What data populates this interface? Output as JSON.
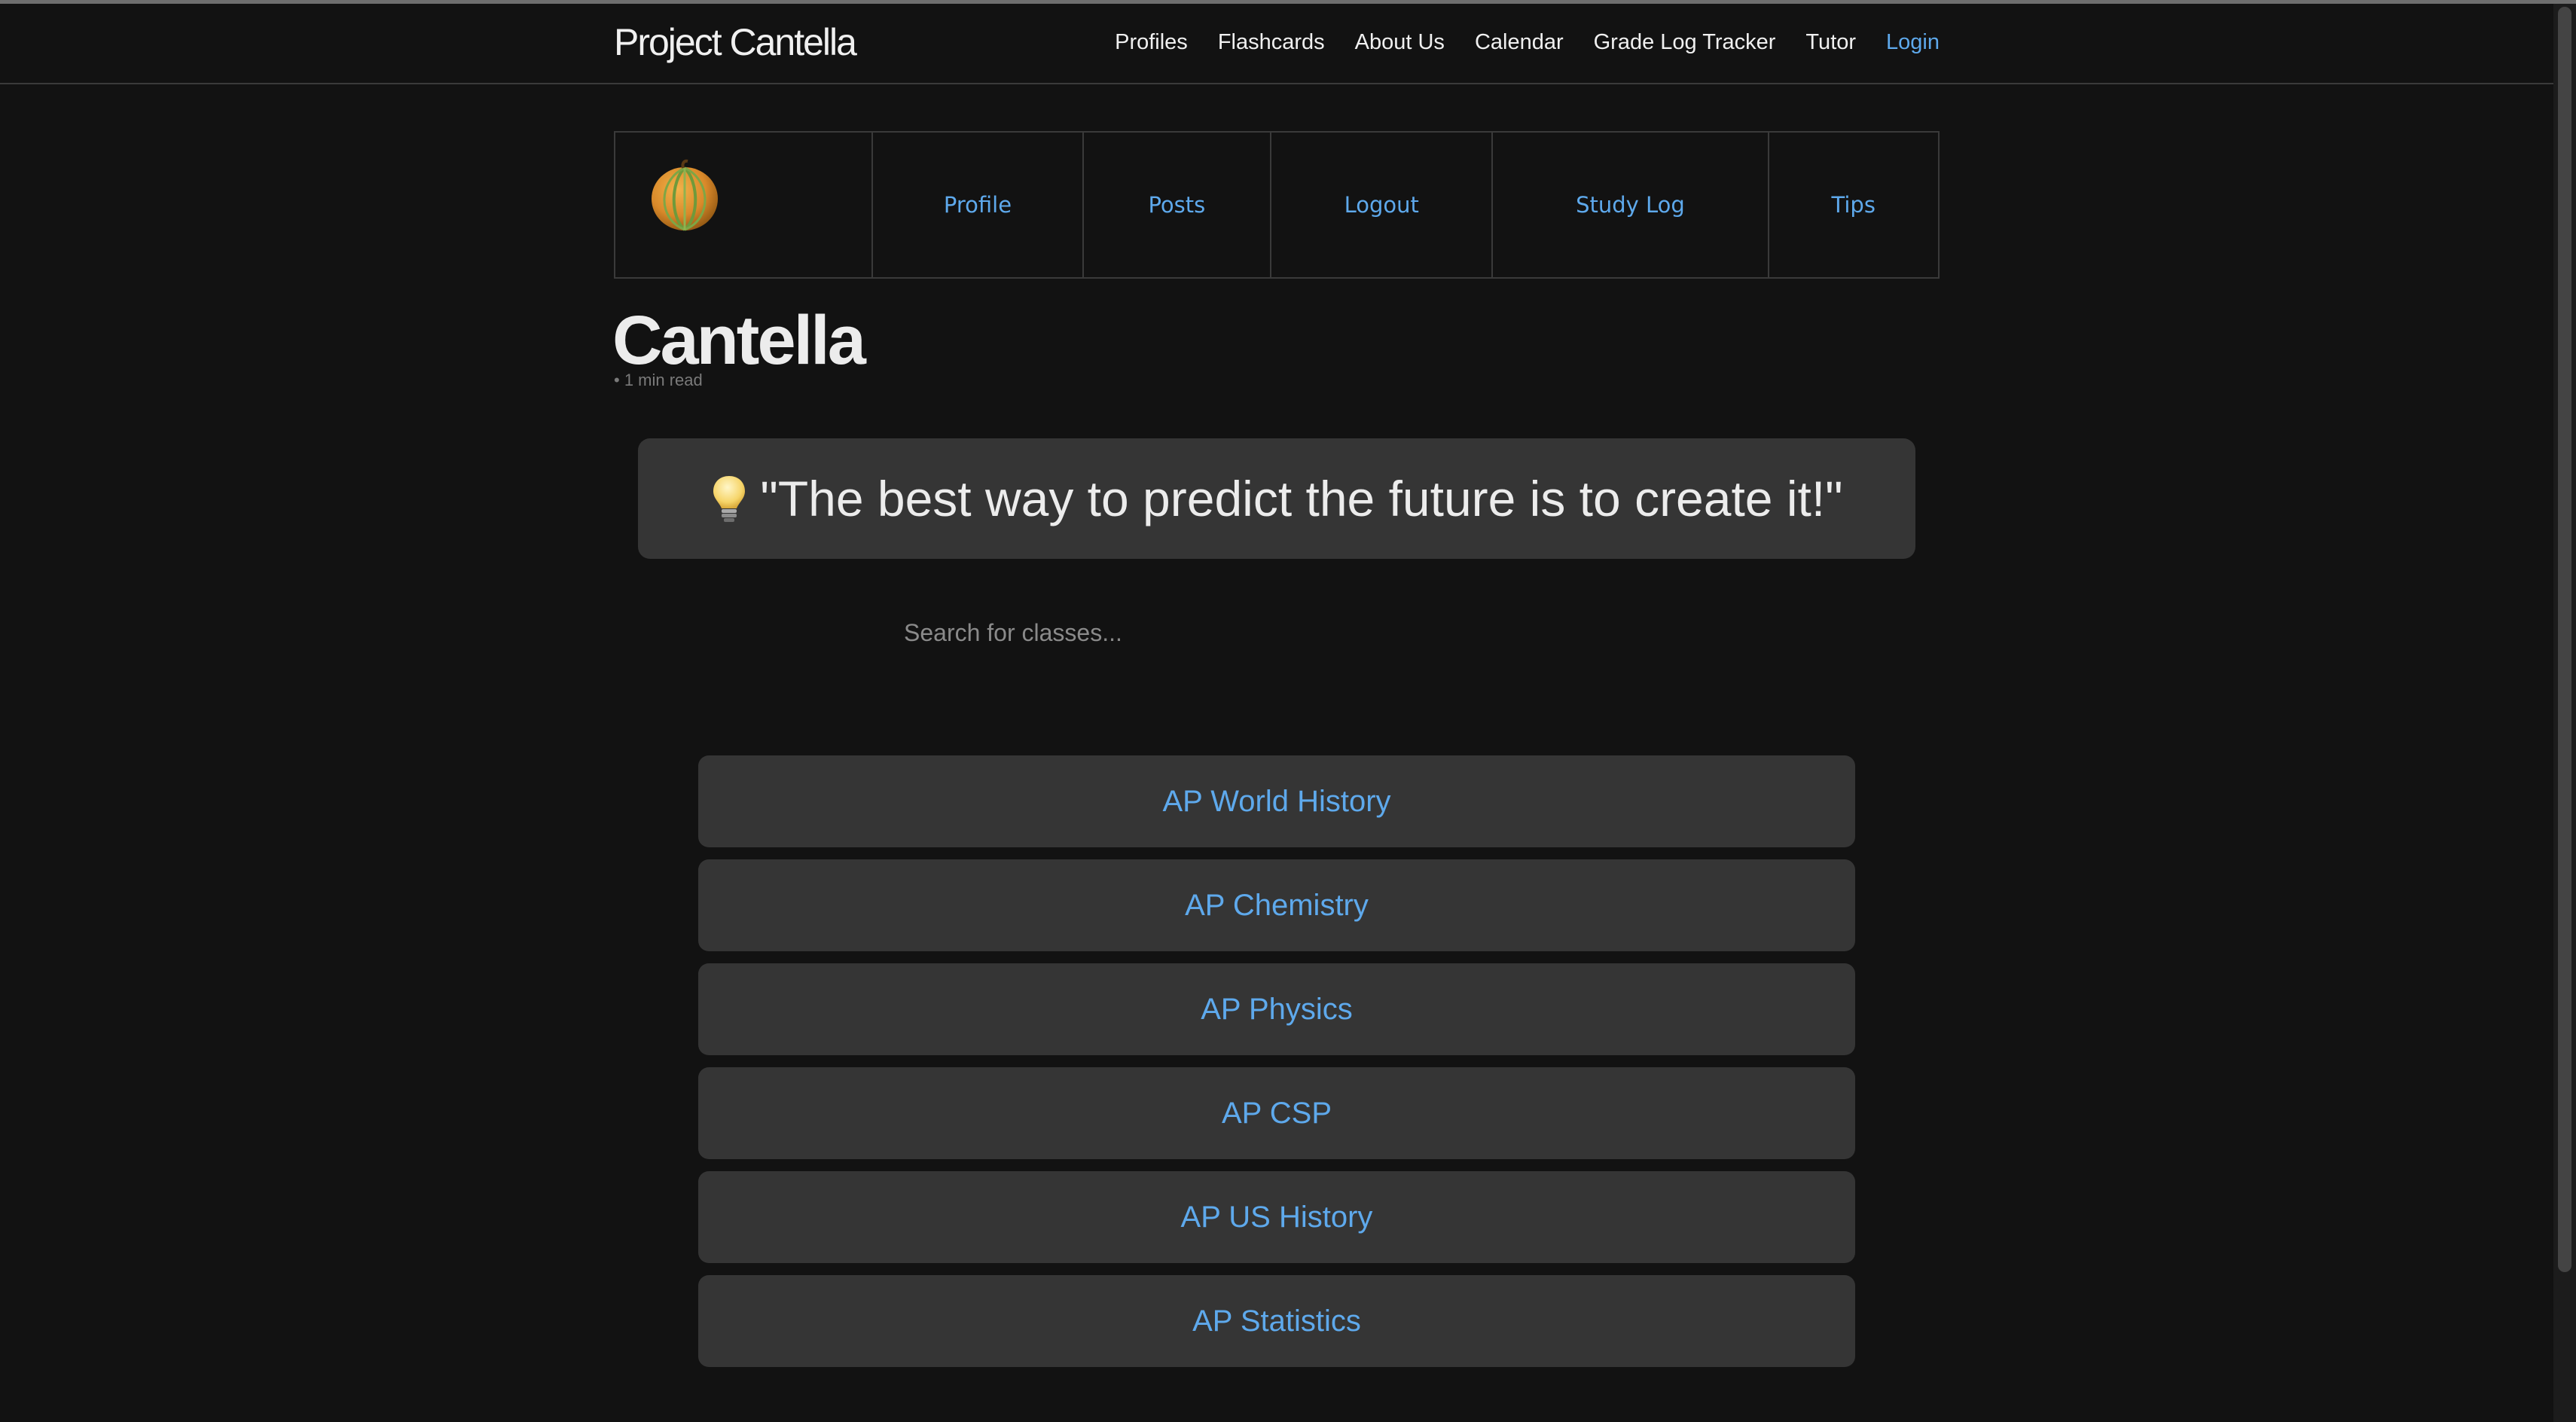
{
  "site": {
    "title": "Project Cantella"
  },
  "nav": {
    "items": [
      {
        "label": "Profiles"
      },
      {
        "label": "Flashcards"
      },
      {
        "label": "About Us"
      },
      {
        "label": "Calendar"
      },
      {
        "label": "Grade Log Tracker"
      },
      {
        "label": "Tutor"
      }
    ],
    "login": "Login"
  },
  "subnav": {
    "logo_icon": "cantaloupe-icon",
    "items": [
      {
        "label": "Profile"
      },
      {
        "label": "Posts"
      },
      {
        "label": "Logout"
      },
      {
        "label": "Study Log"
      },
      {
        "label": "Tips"
      }
    ]
  },
  "page": {
    "title": "Cantella",
    "meta": "• 1 min read"
  },
  "quote": {
    "icon": "lightbulb-icon",
    "text": "\"The best way to predict the future is to create it!\""
  },
  "search": {
    "placeholder": "Search for classes...",
    "value": ""
  },
  "classes": [
    {
      "label": "AP World History"
    },
    {
      "label": "AP Chemistry"
    },
    {
      "label": "AP Physics"
    },
    {
      "label": "AP CSP"
    },
    {
      "label": "AP US History"
    },
    {
      "label": "AP Statistics"
    }
  ],
  "colors": {
    "background": "#121212",
    "link": "#5ea9ec",
    "panel": "#353535",
    "border": "#3a3a3a"
  }
}
